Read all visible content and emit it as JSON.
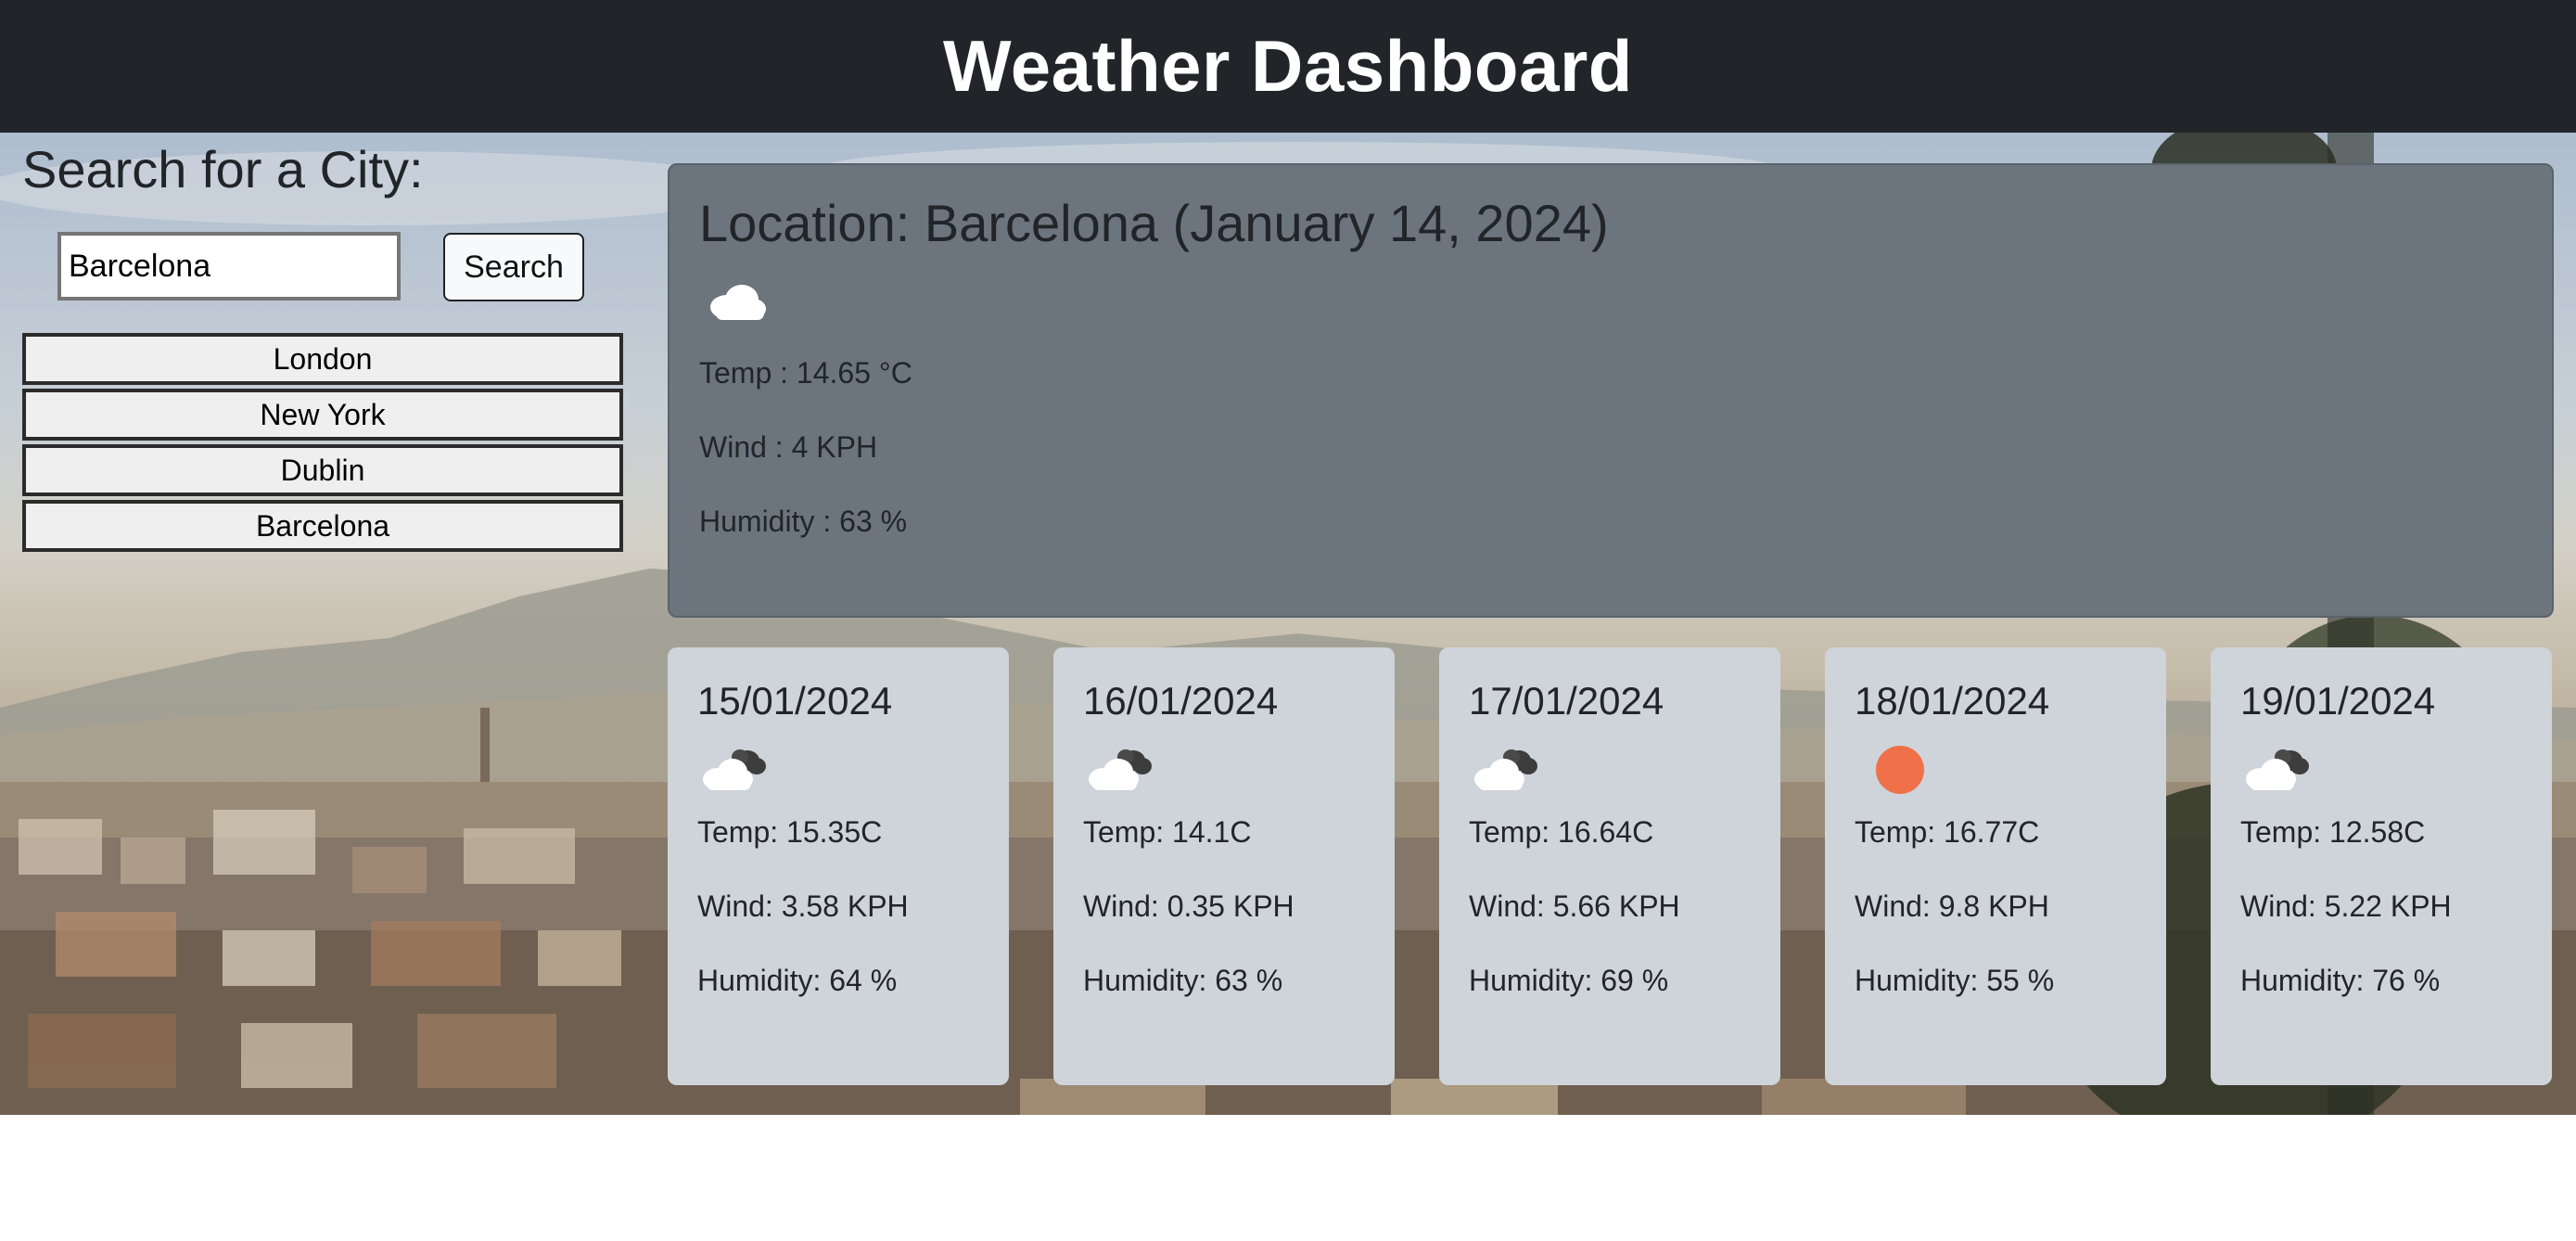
{
  "header": {
    "title": "Weather Dashboard"
  },
  "sidebar": {
    "title": "Search for a City:",
    "search": {
      "value": "Barcelona",
      "button": "Search"
    },
    "history": [
      "London",
      "New York",
      "Dublin",
      "Barcelona"
    ]
  },
  "current": {
    "heading": "Location: Barcelona (January 14, 2024)",
    "icon": "cloud-icon",
    "temp": "Temp : 14.65 °C",
    "wind": "Wind : 4 KPH",
    "humidity": "Humidity : 63 %"
  },
  "forecast": [
    {
      "date": "15/01/2024",
      "icon": "broken-clouds-icon",
      "temp": "Temp: 15.35C",
      "wind": "Wind: 3.58 KPH",
      "humidity": "Humidity: 64 %"
    },
    {
      "date": "16/01/2024",
      "icon": "broken-clouds-icon",
      "temp": "Temp: 14.1C",
      "wind": "Wind: 0.35 KPH",
      "humidity": "Humidity: 63 %"
    },
    {
      "date": "17/01/2024",
      "icon": "broken-clouds-icon",
      "temp": "Temp: 16.64C",
      "wind": "Wind: 5.66 KPH",
      "humidity": "Humidity: 69 %"
    },
    {
      "date": "18/01/2024",
      "icon": "sun-icon",
      "temp": "Temp: 16.77C",
      "wind": "Wind: 9.8 KPH",
      "humidity": "Humidity: 55 %"
    },
    {
      "date": "19/01/2024",
      "icon": "broken-clouds-icon",
      "temp": "Temp: 12.58C",
      "wind": "Wind: 5.22 KPH",
      "humidity": "Humidity: 76 %"
    }
  ],
  "colors": {
    "header_bg": "#212529",
    "current_card_bg": "#6c757d",
    "forecast_card_bg": "#ced4da",
    "sun": "#f0704a"
  }
}
